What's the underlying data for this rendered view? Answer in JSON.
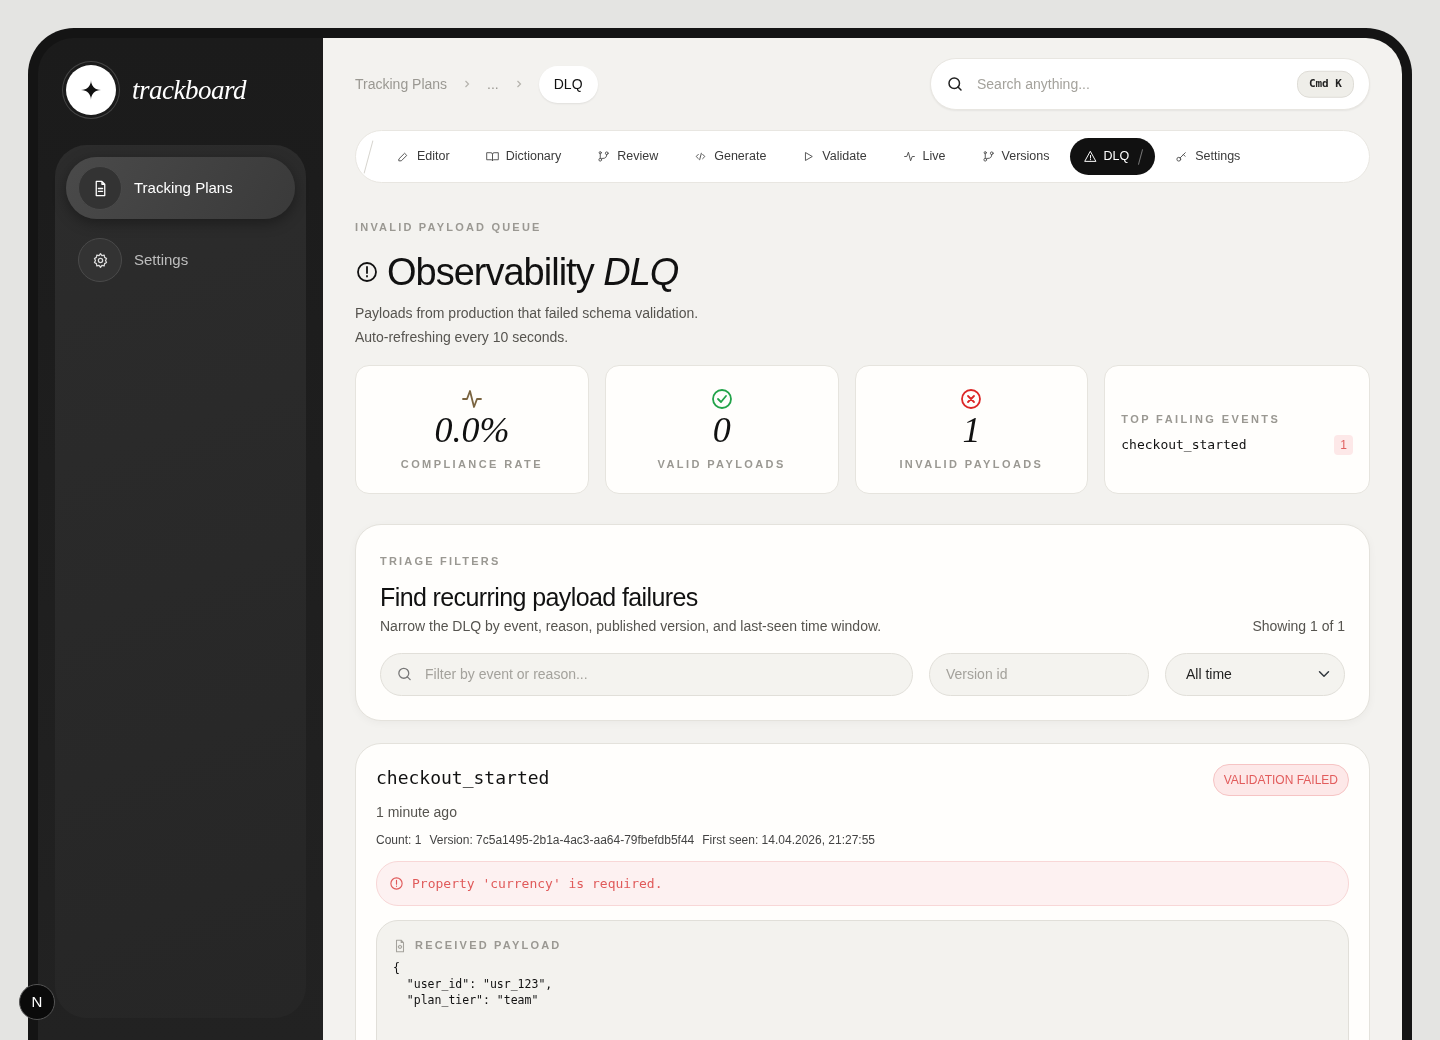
{
  "brand": {
    "name": "trackboard"
  },
  "sidebar": {
    "items": [
      {
        "label": "Tracking Plans",
        "selected": true
      },
      {
        "label": "Settings",
        "selected": false
      }
    ]
  },
  "dev_badge": {
    "label": "N"
  },
  "breadcrumb": [
    {
      "label": "Tracking Plans",
      "current": false
    },
    {
      "label": "...",
      "current": false
    },
    {
      "label": "DLQ",
      "current": true
    }
  ],
  "search": {
    "placeholder": "Search anything...",
    "shortcut": "Cmd K"
  },
  "tabs": [
    {
      "label": "Editor",
      "selected": false
    },
    {
      "label": "Dictionary",
      "selected": false
    },
    {
      "label": "Review",
      "selected": false
    },
    {
      "label": "Generate",
      "selected": false
    },
    {
      "label": "Validate",
      "selected": false
    },
    {
      "label": "Live",
      "selected": false
    },
    {
      "label": "Versions",
      "selected": false
    },
    {
      "label": "DLQ",
      "selected": true
    },
    {
      "label": "Settings",
      "selected": false
    }
  ],
  "header": {
    "eyebrow": "INVALID PAYLOAD QUEUE",
    "title": "Observability *DLQ*",
    "description": [
      "Payloads from production that failed schema validation.",
      "Auto-refreshing every 10 seconds."
    ]
  },
  "stats": [
    {
      "kind": "stat",
      "value": "0.0%",
      "label": "COMPLIANCE RATE"
    },
    {
      "kind": "stat",
      "value": "0",
      "label": "VALID PAYLOADS"
    },
    {
      "kind": "stat",
      "value": "1",
      "label": "INVALID PAYLOADS"
    },
    {
      "kind": "top_events",
      "title": "TOP FAILING EVENTS",
      "events": [
        {
          "name": "checkout_started",
          "count": "1"
        }
      ]
    }
  ],
  "filters": {
    "eyebrow": "TRIAGE FILTERS",
    "title": "Find recurring payload failures",
    "description": "Narrow the DLQ by event, reason, published version, and last-seen time window.",
    "result_count": "Showing 1 of 1",
    "search_placeholder": "Filter by event or reason...",
    "version_placeholder": "Version id",
    "time_range": "All time"
  },
  "events": [
    {
      "name": "checkout_started",
      "status": "VALIDATION FAILED",
      "time": "1 minute ago",
      "meta": [
        "Count: 1",
        "Version: 7c5a1495-2b1a-4ac3-aa64-79fbefdb5f44",
        "First seen: 14.04.2026, 21:27:55"
      ],
      "error": "Property 'currency' is required.",
      "payload_label": "RECEIVED PAYLOAD",
      "payload": [
        "{",
        "  \"user_id\": \"usr_123\",",
        "  \"plan_tier\": \"team\""
      ]
    }
  ]
}
